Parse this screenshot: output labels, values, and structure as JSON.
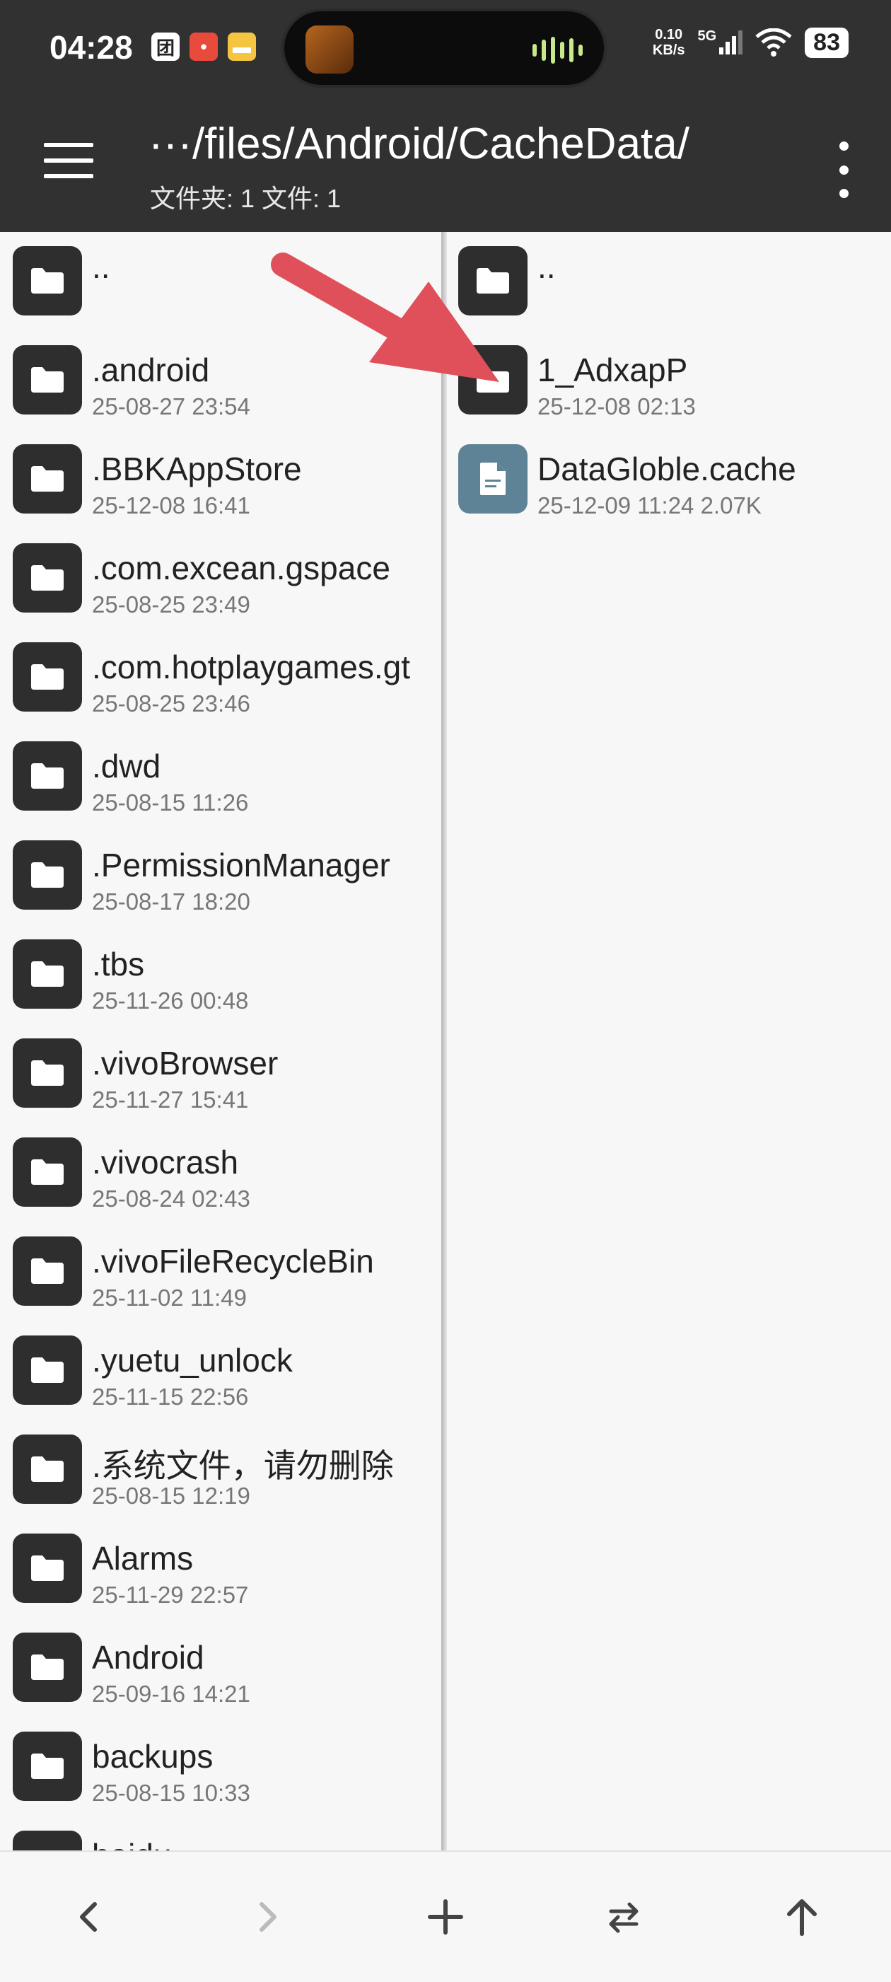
{
  "status": {
    "time": "04:28",
    "mini_icons": [
      "团",
      "",
      ""
    ],
    "net_speed_value": "0.10",
    "net_speed_unit": "KB/s",
    "signal": "5G",
    "battery": "83"
  },
  "appbar": {
    "path": "···/files/Android/CacheData/",
    "summary": "文件夹: 1  文件: 1"
  },
  "left_pane": {
    "parent": "..",
    "items": [
      {
        "name": ".android",
        "date": "25-08-27 23:54"
      },
      {
        "name": ".BBKAppStore",
        "date": "25-12-08 16:41"
      },
      {
        "name": ".com.excean.gspace",
        "date": "25-08-25 23:49"
      },
      {
        "name": ".com.hotplaygames.gt",
        "date": "25-08-25 23:46"
      },
      {
        "name": ".dwd",
        "date": "25-08-15 11:26"
      },
      {
        "name": ".PermissionManager",
        "date": "25-08-17 18:20"
      },
      {
        "name": ".tbs",
        "date": "25-11-26 00:48"
      },
      {
        "name": ".vivoBrowser",
        "date": "25-11-27 15:41"
      },
      {
        "name": ".vivocrash",
        "date": "25-08-24 02:43"
      },
      {
        "name": ".vivoFileRecycleBin",
        "date": "25-11-02 11:49"
      },
      {
        "name": ".yuetu_unlock",
        "date": "25-11-15 22:56"
      },
      {
        "name": ".系统文件，请勿删除",
        "date": "25-08-15 12:19"
      },
      {
        "name": "Alarms",
        "date": "25-11-29 22:57"
      },
      {
        "name": "Android",
        "date": "25-09-16 14:21"
      },
      {
        "name": "backups",
        "date": "25-08-15 10:33"
      },
      {
        "name": "baidu",
        "date": ""
      }
    ]
  },
  "right_pane": {
    "parent": "..",
    "items": [
      {
        "name": "1_AdxapP",
        "date": "25-12-08 02:13",
        "type": "folder"
      },
      {
        "name": "DataGloble.cache",
        "date": "25-12-09 11:24  2.07K",
        "type": "file"
      }
    ]
  },
  "icons": {
    "folder": "folder-icon",
    "file": "file-icon",
    "back": "chevron-left-icon",
    "forward": "chevron-right-icon",
    "add": "plus-icon",
    "swap": "swap-icon",
    "up": "arrow-up-icon"
  },
  "colors": {
    "bar": "#313131",
    "folder_icon": "#2e2e2e",
    "file_icon": "#5f8396",
    "annotation_arrow": "#e0505a"
  }
}
